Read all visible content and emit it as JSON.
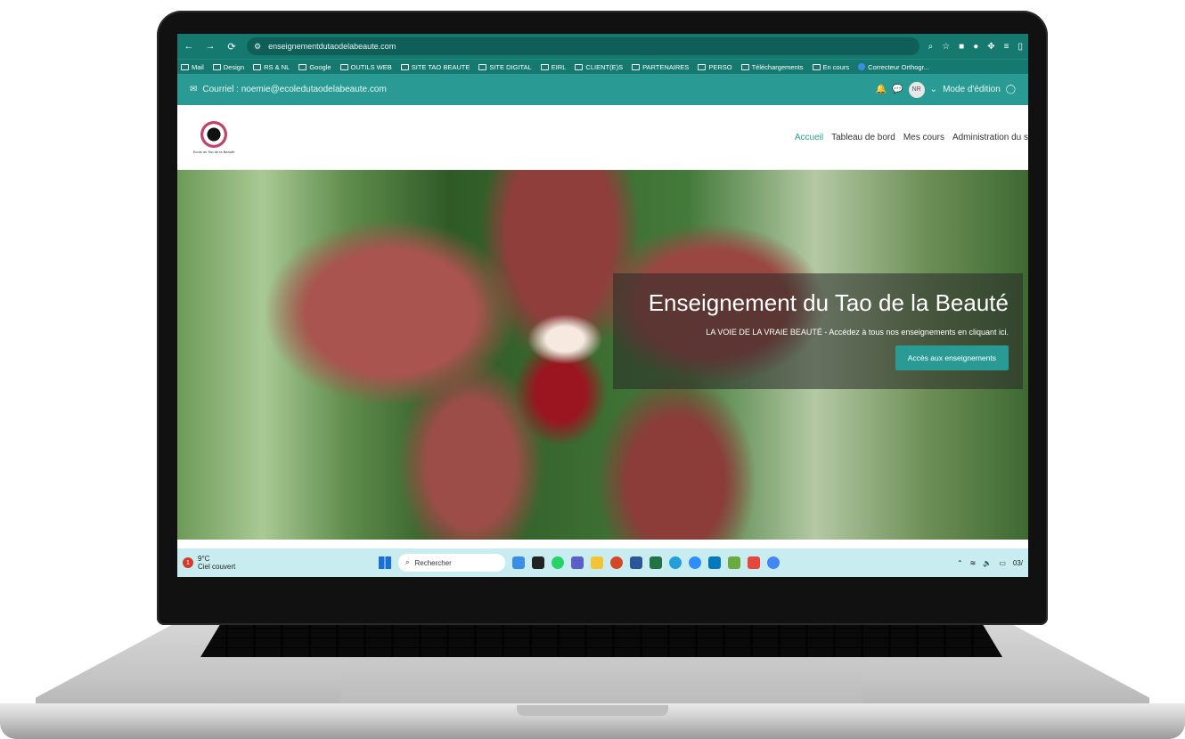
{
  "browser": {
    "url": "enseignementdutaodelabeaute.com",
    "bookmarks": [
      "Mail",
      "Design",
      "RS & NL",
      "Google",
      "OUTILS WEB",
      "SITE TAO BEAUTE",
      "SITE DIGITAL",
      "EIRL",
      "CLIENT(E)S",
      "PARTENAIRES",
      "PERSO",
      "Téléchargements",
      "En cours",
      "Correcteur Orthogr..."
    ]
  },
  "site_bar": {
    "email": "Courriel : noemie@ecoledutaodelabeaute.com",
    "avatar_initials": "NR",
    "edit_mode": "Mode d'édition"
  },
  "logo": {
    "text": "Ecole du Tao de la Beauté"
  },
  "nav": {
    "items": [
      "Accueil",
      "Tableau de bord",
      "Mes cours",
      "Administration du s"
    ]
  },
  "hero": {
    "title": "Enseignement du Tao de la Beauté",
    "subtitle": "LA VOIE DE LA VRAIE BEAUTÉ - Accédez à tous nos enseignements en cliquant ici.",
    "button": "Accès aux enseignements"
  },
  "taskbar": {
    "temperature": "9°C",
    "weather": "Ciel couvert",
    "weather_badge": "1",
    "search_label": "Rechercher",
    "date_partial": "03/"
  },
  "colors": {
    "accent": "#2a9b94",
    "chrome": "#16796f",
    "taskbar": "#c9ecf0"
  }
}
